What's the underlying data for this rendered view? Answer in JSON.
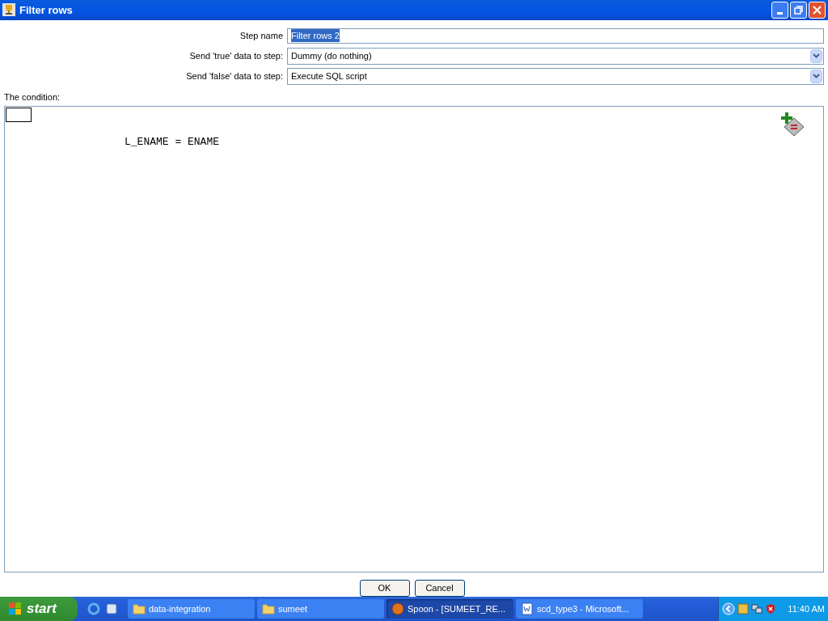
{
  "window": {
    "title": "Filter rows"
  },
  "form": {
    "step_name": {
      "label": "Step name",
      "value": "Filter rows 2"
    },
    "true_step": {
      "label": "Send 'true' data to step:",
      "value": "Dummy (do nothing)"
    },
    "false_step": {
      "label": "Send 'false' data to step:",
      "value": "Execute SQL script"
    }
  },
  "condition": {
    "label": "The condition:",
    "expression": "L_ENAME = ENAME"
  },
  "buttons": [
    "OK",
    "Cancel"
  ],
  "taskbar": {
    "start": "start",
    "tasks": [
      {
        "label": "data-integration",
        "kind": "folder",
        "selected": false
      },
      {
        "label": "sumeet",
        "kind": "folder",
        "selected": false
      },
      {
        "label": "Spoon - [SUMEET_RE...",
        "kind": "spoon",
        "selected": true
      },
      {
        "label": "scd_type3 - Microsoft...",
        "kind": "word",
        "selected": false
      }
    ],
    "clock": "11:40 AM"
  }
}
